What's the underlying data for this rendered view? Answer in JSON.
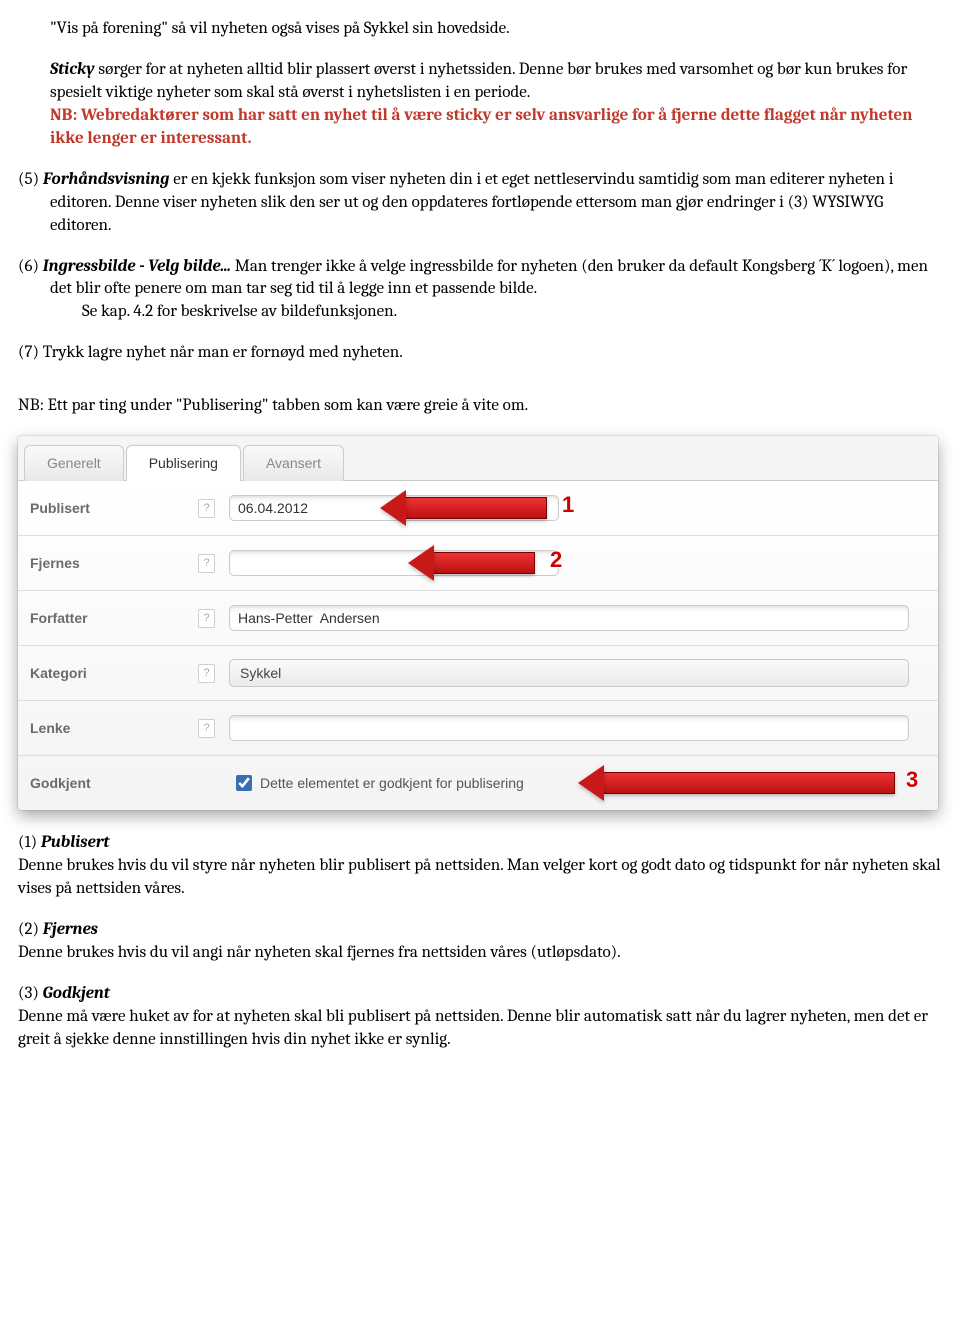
{
  "intro": {
    "line1": "\"Vis på forening\" så vil nyheten også vises på Sykkel sin hovedside.",
    "sticky_label": "Sticky",
    "sticky_rest": " sørger for at nyheten alltid blir plassert øverst i nyhetssiden. Denne bør brukes med varsomhet og bør kun brukes for spesielt viktige nyheter som skal stå øverst i nyhetslisten i en periode.",
    "warn": "NB: Webredaktører som har satt en nyhet til å være sticky er selv ansvarlige for å fjerne dette flagget når nyheten ikke lenger er interessant."
  },
  "item5": {
    "prefix": "(5) ",
    "label": "Forhåndsvisning",
    "rest": " er en kjekk funksjon som viser nyheten din i et eget nettleservindu samtidig som man editerer nyheten i editoren. Denne viser nyheten slik den ser ut og den oppdateres fortløpende ettersom man gjør endringer i (3) WYSIWYG editoren."
  },
  "item6": {
    "prefix": "(6) ",
    "label": "Ingressbilde - Velg bilde...",
    "rest": " Man trenger ikke å velge ingressbilde for nyheten (den bruker da default Kongsberg ´K´ logoen), men det blir ofte penere om man tar seg tid til å legge inn et passende bilde.",
    "line2": "Se kap. 4.2 for beskrivelse av bildefunksjonen."
  },
  "item7": "(7) Trykk lagre nyhet når man er fornøyd med nyheten.",
  "nb_line": "NB: Ett par ting under \"Publisering\" tabben som kan være greie å vite om.",
  "form": {
    "tabs": {
      "generelt": "Generelt",
      "publisering": "Publisering",
      "avansert": "Avansert"
    },
    "publisert_label": "Publisert",
    "publisert_value": "06.04.2012",
    "fjernes_label": "Fjernes",
    "fjernes_value": "",
    "forfatter_label": "Forfatter",
    "forfatter_value": "Hans-Petter  Andersen",
    "kategori_label": "Kategori",
    "kategori_value": "Sykkel",
    "lenke_label": "Lenke",
    "lenke_value": "",
    "godkjent_label": "Godkjent",
    "godkjent_text": "Dette elementet er godkjent for publisering",
    "callouts": {
      "n1": "1",
      "n2": "2",
      "n3": "3"
    },
    "help_char": "?"
  },
  "desc1": {
    "prefix": "(1) ",
    "label": "Publisert",
    "body": "Denne brukes hvis du vil styre når nyheten blir publisert på nettsiden. Man velger kort og godt dato og tidspunkt for når nyheten skal vises på nettsiden våres."
  },
  "desc2": {
    "prefix": "(2) ",
    "label": "Fjernes",
    "body": "Denne brukes hvis du vil angi når nyheten skal fjernes fra nettsiden våres (utløpsdato)."
  },
  "desc3": {
    "prefix": "(3) ",
    "label": "Godkjent",
    "body": "Denne må være huket av for at nyheten skal bli publisert på nettsiden. Denne blir automatisk satt når du lagrer nyheten, men det er greit å sjekke denne innstillingen hvis din nyhet ikke er synlig."
  }
}
